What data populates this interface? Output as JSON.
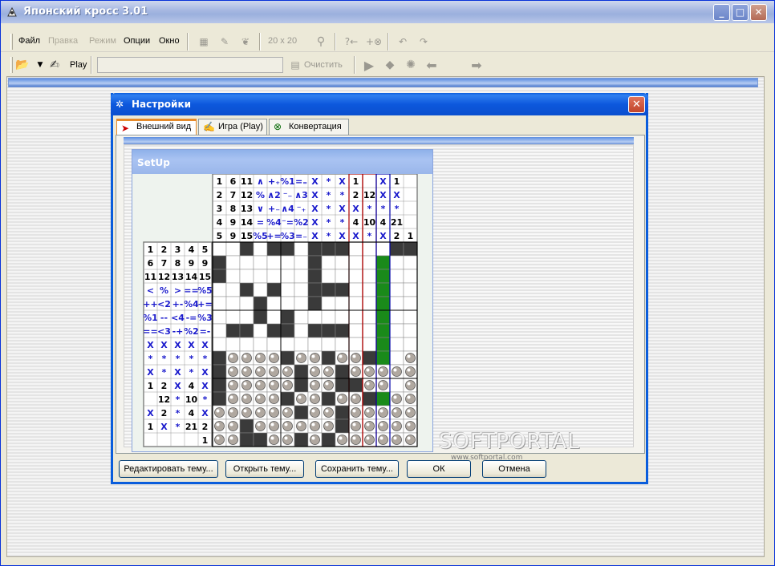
{
  "window": {
    "title": "Японский кросс 3.01"
  },
  "menu": {
    "items": [
      {
        "label": "Файл",
        "enabled": true
      },
      {
        "label": "Правка",
        "enabled": false
      },
      {
        "label": "Режим",
        "enabled": false
      },
      {
        "label": "Опции",
        "enabled": true
      },
      {
        "label": "Окно",
        "enabled": true
      }
    ]
  },
  "toolbar1": {
    "size_label": "20 x 20"
  },
  "toolbar2": {
    "play_label": "Play",
    "clear_label": "Очистить",
    "combo_value": ""
  },
  "dialog": {
    "title": "Настройки",
    "tabs": [
      {
        "label": "Внешний вид",
        "selected": true
      },
      {
        "label": "Игра (Play)",
        "selected": false
      },
      {
        "label": "Конвертация",
        "selected": false
      }
    ],
    "preview_title": "SetUp",
    "buttons": {
      "edit": "Редактировать тему...",
      "open": "Открыть тему...",
      "save": "Сохранить тему...",
      "ok": "ОК",
      "cancel": "Отмена"
    }
  },
  "puzzle": {
    "col_clues": [
      [
        "1",
        "2",
        "3",
        "4",
        "5"
      ],
      [
        "6",
        "7",
        "8",
        "9",
        "9"
      ],
      [
        "11",
        "12",
        "13",
        "14",
        "15"
      ],
      [
        "∧",
        "%",
        "∨",
        "=",
        "%5"
      ],
      [
        "+₊",
        "∧2",
        "+₋",
        "%4",
        "+="
      ],
      [
        "%1",
        "⁻₋",
        "∧4",
        "⁻=",
        "%3"
      ],
      [
        "=₌",
        "∧3",
        "⁻₊",
        "%2",
        "=₋"
      ],
      [
        "X",
        "X",
        "X",
        "X",
        "X"
      ],
      [
        "*",
        "*",
        "*",
        "*",
        "*"
      ],
      [
        "X",
        "*",
        "X",
        "*",
        "X"
      ],
      [
        "1",
        "2",
        "X",
        "4",
        "X"
      ],
      [
        "",
        "12",
        "*",
        "10",
        "*"
      ],
      [
        "X",
        "X",
        "*",
        "4",
        "X"
      ],
      [
        "1",
        "X",
        "*",
        "21",
        "2"
      ],
      [
        "",
        "",
        "",
        "",
        "1"
      ]
    ],
    "row_clues": [
      [
        "1",
        "2",
        "3",
        "4",
        "5"
      ],
      [
        "6",
        "7",
        "8",
        "9",
        "9"
      ],
      [
        "11",
        "12",
        "13",
        "14",
        "15"
      ],
      [
        "<",
        "%",
        ">",
        "==",
        "%5"
      ],
      [
        "++",
        "<2",
        "+-",
        "%4",
        "+="
      ],
      [
        "%1",
        "--",
        "<4",
        "-=",
        "%3"
      ],
      [
        "==",
        "<3",
        "-+",
        "%2",
        "=-"
      ],
      [
        "X",
        "X",
        "X",
        "X",
        "X"
      ],
      [
        "*",
        "*",
        "*",
        "*",
        "*"
      ],
      [
        "X",
        "*",
        "X",
        "*",
        "X"
      ],
      [
        "1",
        "2",
        "X",
        "4",
        "X"
      ],
      [
        "",
        "12",
        "*",
        "10",
        "*"
      ],
      [
        "X",
        "2",
        "*",
        "4",
        "X"
      ],
      [
        "1",
        "X",
        "*",
        "21",
        "2"
      ],
      [
        "",
        "",
        "",
        "",
        "1"
      ]
    ]
  },
  "watermark": {
    "text": "SOFTPORTAL",
    "url": "www.softportal.com"
  }
}
